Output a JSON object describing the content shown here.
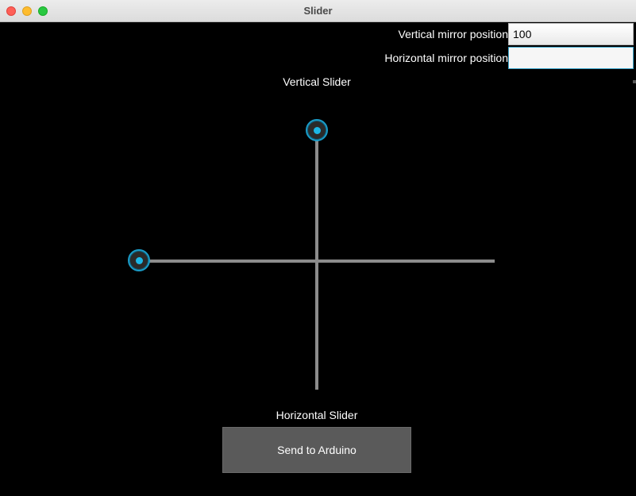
{
  "window": {
    "title": "Slider"
  },
  "fields": {
    "vertical": {
      "label": "Vertical mirror position",
      "value": "100"
    },
    "horizontal": {
      "label": "Horizontal mirror position",
      "value": ""
    }
  },
  "sliders": {
    "vertical": {
      "label": "Vertical Slider"
    },
    "horizontal": {
      "label": "Horizontal Slider"
    }
  },
  "buttons": {
    "send_label": "Send to Arduino"
  },
  "colors": {
    "accent": "#1cb7e6",
    "track": "#8c8c8c",
    "background": "#000000",
    "button": "#5a5a5a"
  }
}
